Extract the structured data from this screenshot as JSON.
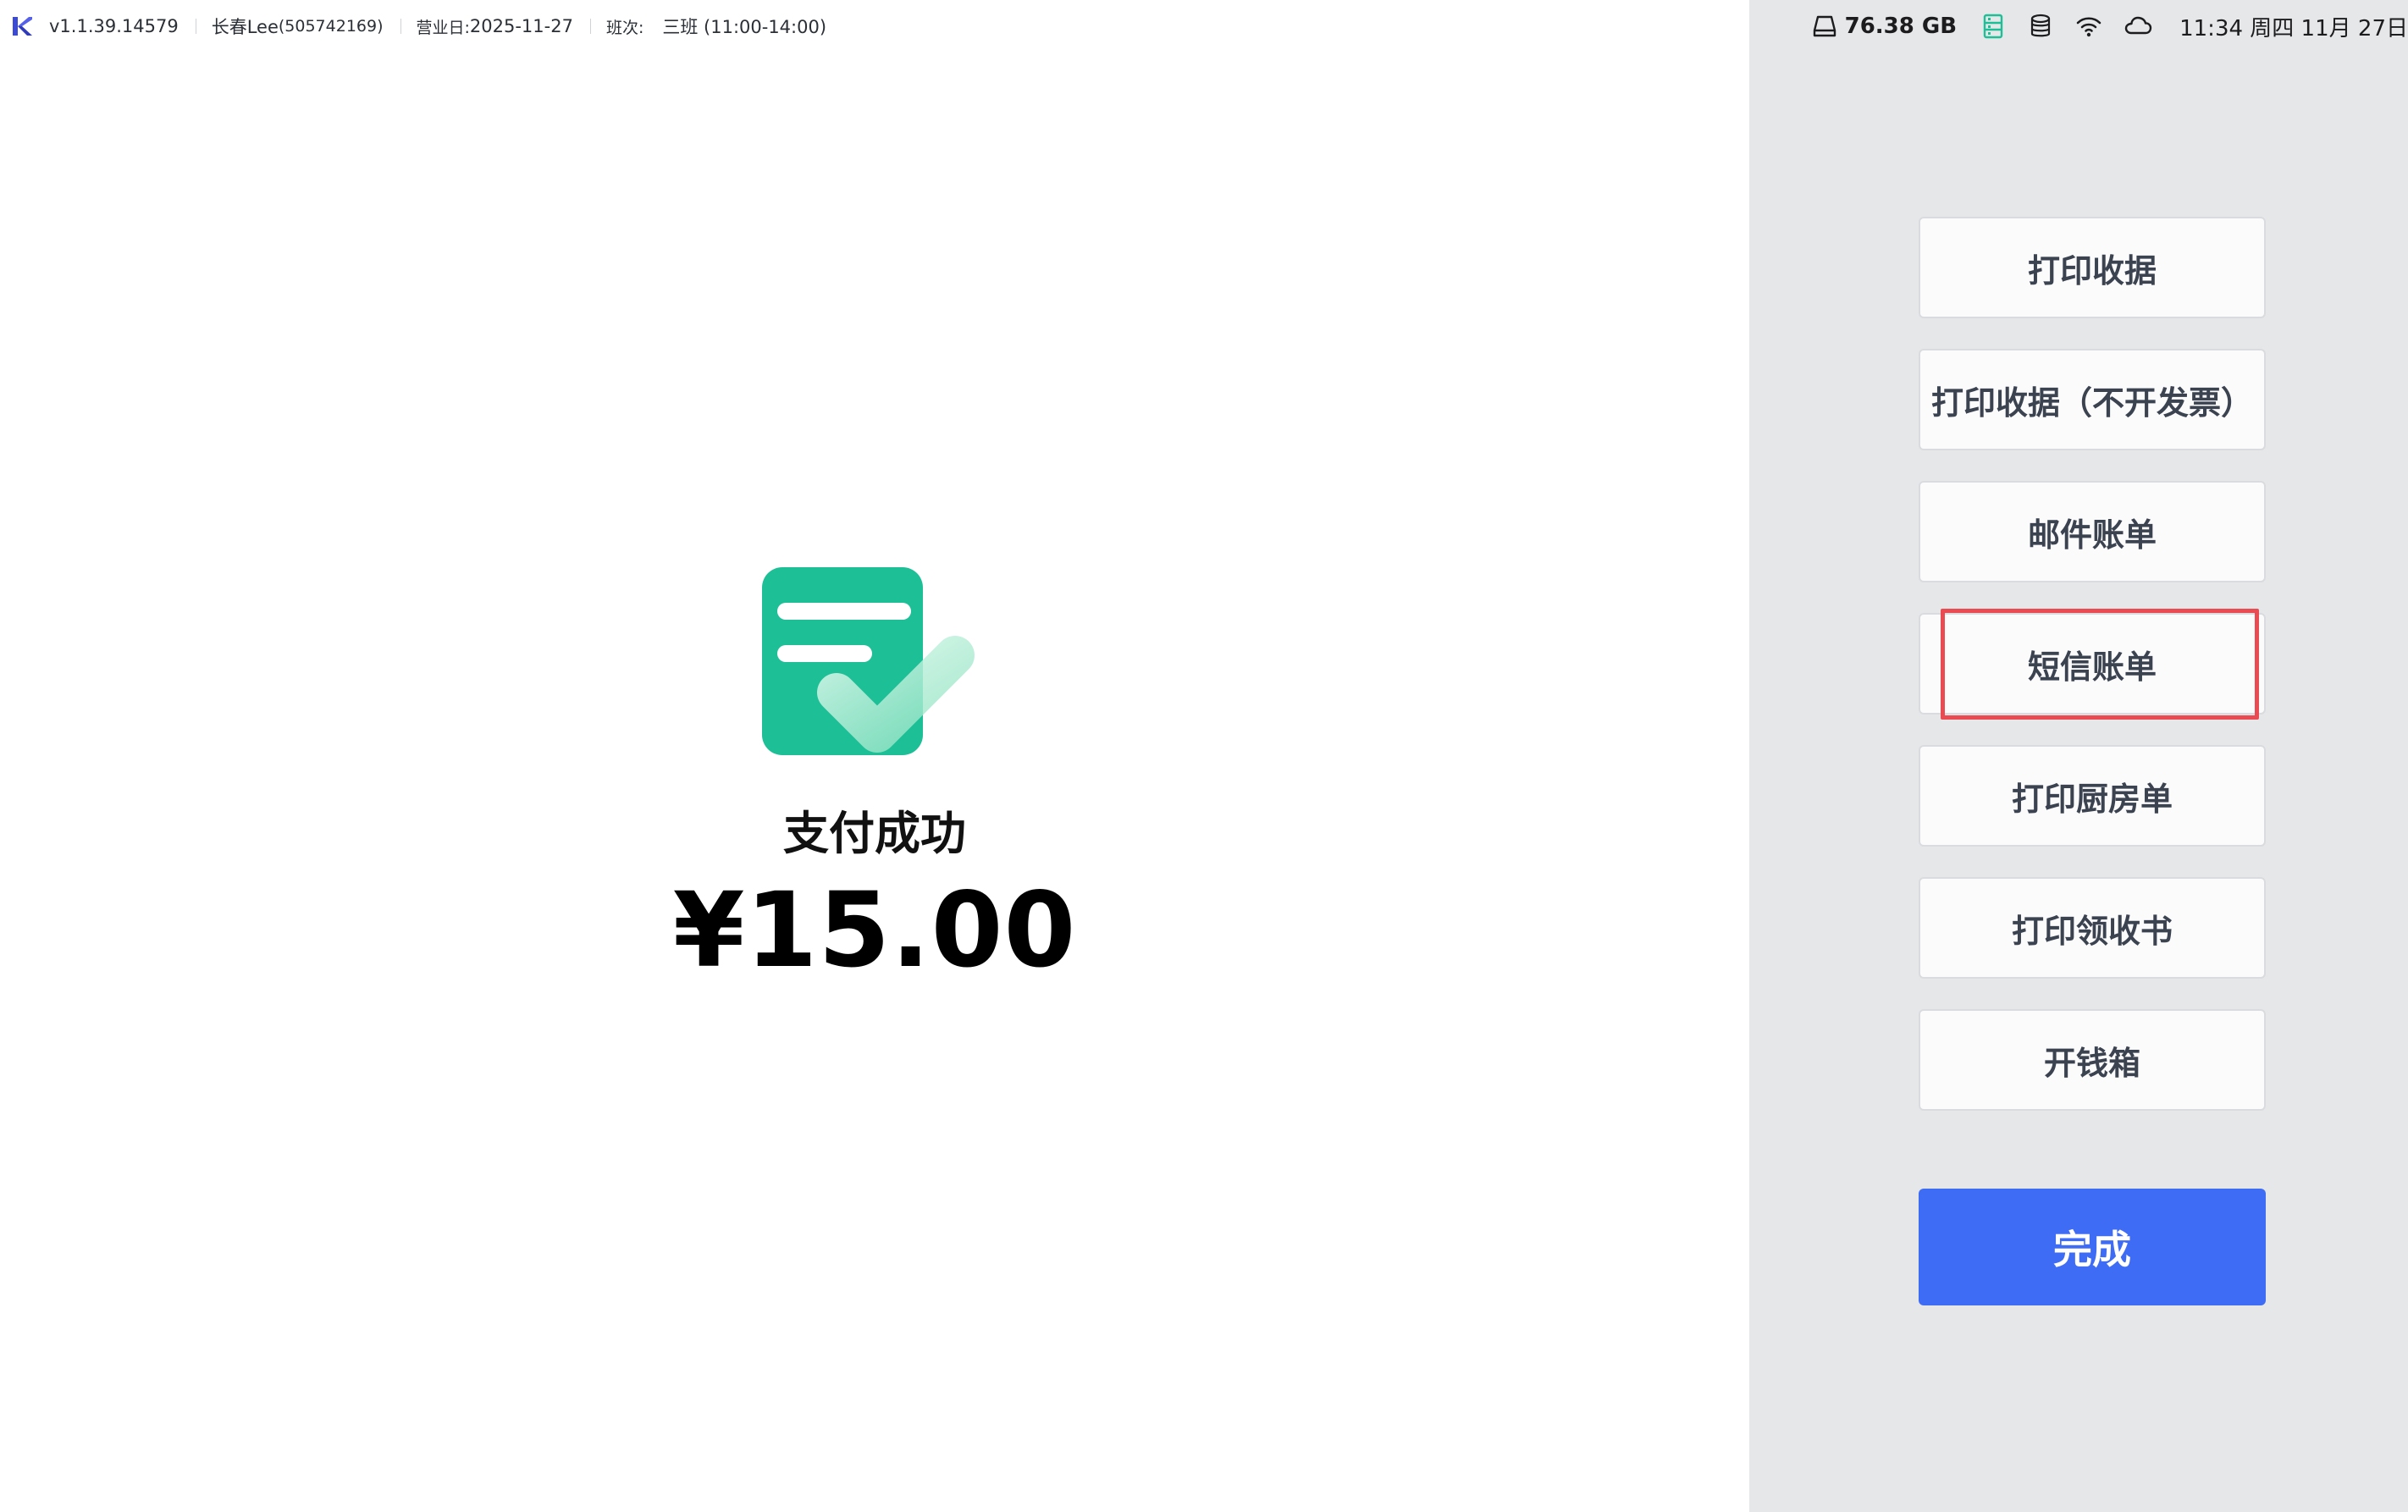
{
  "topbar": {
    "version": "v1.1.39.14579",
    "user_name": "长春Lee",
    "user_id": "(505742169)",
    "business_day_label": "营业日:",
    "business_day_value": "2025-11-27",
    "shift_label": "班次:",
    "shift_value": "三班 (11:00-14:00)"
  },
  "statusbar": {
    "disk_free": "76.38 GB",
    "clock": "11:34 周四 11月 27日"
  },
  "payment": {
    "status_title": "支付成功",
    "amount": "¥15.00"
  },
  "actions": [
    {
      "label": "打印收据"
    },
    {
      "label": "打印收据（不开发票）"
    },
    {
      "label": "邮件账单"
    },
    {
      "label": "短信账单"
    },
    {
      "label": "打印厨房单"
    },
    {
      "label": "打印领收书"
    },
    {
      "label": "开钱箱"
    }
  ],
  "done_button": {
    "label": "完成"
  },
  "colors": {
    "accent": "#3e6cf4",
    "success_green": "#1dbf96",
    "highlight_red": "#ea4a52",
    "side_panel_bg": "#e6e7e9"
  }
}
